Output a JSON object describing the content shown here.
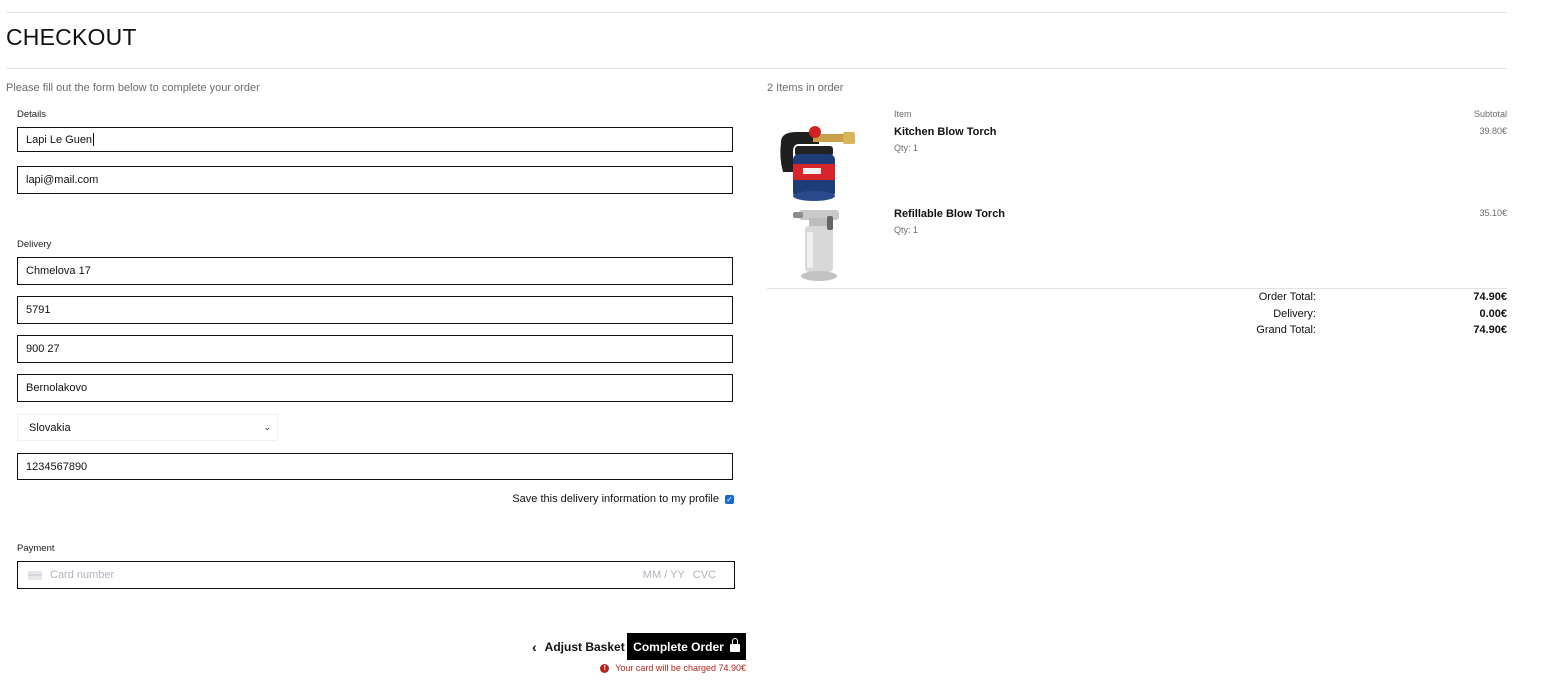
{
  "page": {
    "title": "CHECKOUT",
    "intro": "Please fill out the form below to complete your order"
  },
  "form": {
    "details_label": "Details",
    "full_name": "Lapi Le Guen",
    "email": "lapi@mail.com",
    "delivery_label": "Delivery",
    "street": "Chmelova 17",
    "street2": "5791",
    "postcode": "900 27",
    "town": "Bernolakovo",
    "country": "Slovakia",
    "phone": "1234567890",
    "save_info_label": "Save this delivery information to my profile",
    "save_info_checked": true,
    "payment_label": "Payment",
    "card_number_placeholder": "Card number",
    "card_expiry_placeholder": "MM / YY",
    "card_cvc_placeholder": "CVC"
  },
  "actions": {
    "adjust_basket": "Adjust Basket",
    "complete_order": "Complete Order",
    "charge_notice": "Your card will be charged 74.90€"
  },
  "order": {
    "items_count": "2 Items in order",
    "col_item": "Item",
    "col_subtotal": "Subtotal",
    "items": [
      {
        "name": "Kitchen Blow Torch",
        "qty": "Qty: 1",
        "subtotal": "39.80€",
        "icon": "kitchen-blow-torch-image"
      },
      {
        "name": "Refillable Blow Torch",
        "qty": "Qty: 1",
        "subtotal": "35.10€",
        "icon": "refillable-blow-torch-image"
      }
    ],
    "summary": {
      "order_total_label": "Order Total:",
      "order_total": "74.90€",
      "delivery_label": "Delivery:",
      "delivery": "0.00€",
      "grand_total_label": "Grand Total:",
      "grand_total": "74.90€"
    }
  },
  "colors": {
    "button": "#000000",
    "checkbox": "#1769d3",
    "error": "#b3261e",
    "muted_text": "#6b6b6b"
  }
}
